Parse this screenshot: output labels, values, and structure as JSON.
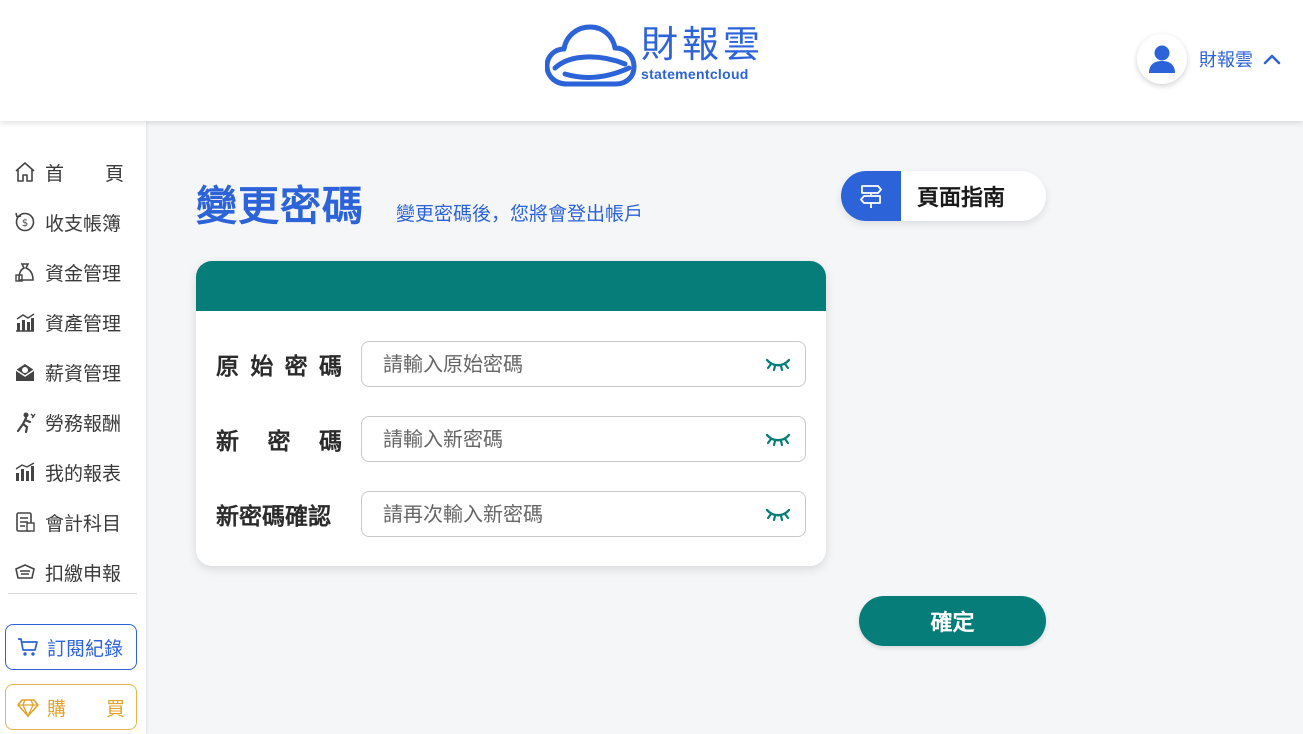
{
  "header": {
    "logo_title": "財報雲",
    "logo_subtitle": "statementcloud",
    "user_name": "財報雲"
  },
  "sidebar": {
    "items": [
      {
        "label_chars": [
          "首",
          "頁"
        ],
        "icon": "home-icon"
      },
      {
        "label": "收支帳簿",
        "icon": "income-expense-icon"
      },
      {
        "label": "資金管理",
        "icon": "money-bag-icon"
      },
      {
        "label": "資產管理",
        "icon": "asset-chart-icon"
      },
      {
        "label": "薪資管理",
        "icon": "salary-envelope-icon"
      },
      {
        "label": "勞務報酬",
        "icon": "worker-icon"
      },
      {
        "label": "我的報表",
        "icon": "bar-chart-icon"
      },
      {
        "label": "會計科目",
        "icon": "ledger-icon"
      },
      {
        "label": "扣繳申報",
        "icon": "tax-filing-icon"
      }
    ],
    "subscription_label": "訂閱紀錄",
    "buy_label_chars": [
      "購",
      "買"
    ]
  },
  "main": {
    "title": "變更密碼",
    "subtitle": "變更密碼後，您將會登出帳戶",
    "guide_label": "頁面指南",
    "fields": [
      {
        "label_chars": [
          "原",
          "始",
          "密",
          "碼"
        ],
        "placeholder": "請輸入原始密碼"
      },
      {
        "label_chars": [
          "新",
          "密",
          "碼"
        ],
        "placeholder": "請輸入新密碼"
      },
      {
        "label_chars": [
          "新密碼確認"
        ],
        "placeholder": "請再次輸入新密碼"
      }
    ],
    "confirm_label": "確定"
  },
  "colors": {
    "brand_blue": "#2c63d8",
    "teal": "#077d7a",
    "gold": "#e0a32c"
  }
}
